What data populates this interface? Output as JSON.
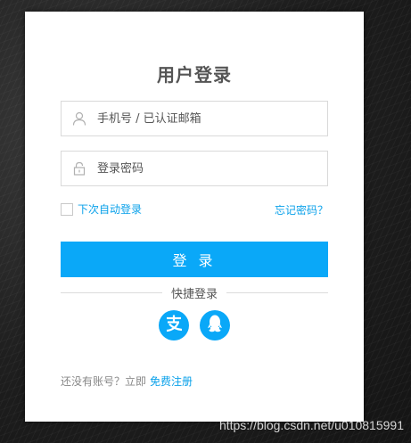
{
  "login": {
    "title": "用户登录",
    "username_placeholder": "手机号 / 已认证邮箱",
    "password_placeholder": "登录密码",
    "remember_label": "下次自动登录",
    "forgot_label": "忘记密码？",
    "submit_label": "登 录",
    "quick_login_label": "快捷登录",
    "social": [
      {
        "name": "alipay",
        "icon": "alipay-icon"
      },
      {
        "name": "qq",
        "icon": "qq-icon"
      }
    ],
    "register_prompt": "还没有账号？立即",
    "register_link": "免费注册"
  },
  "watermark": "https://blog.csdn.net/u010815991",
  "colors": {
    "accent": "#0aa8f8",
    "link": "#0aa1ea",
    "title": "#555555",
    "border": "#d9d9d9"
  }
}
